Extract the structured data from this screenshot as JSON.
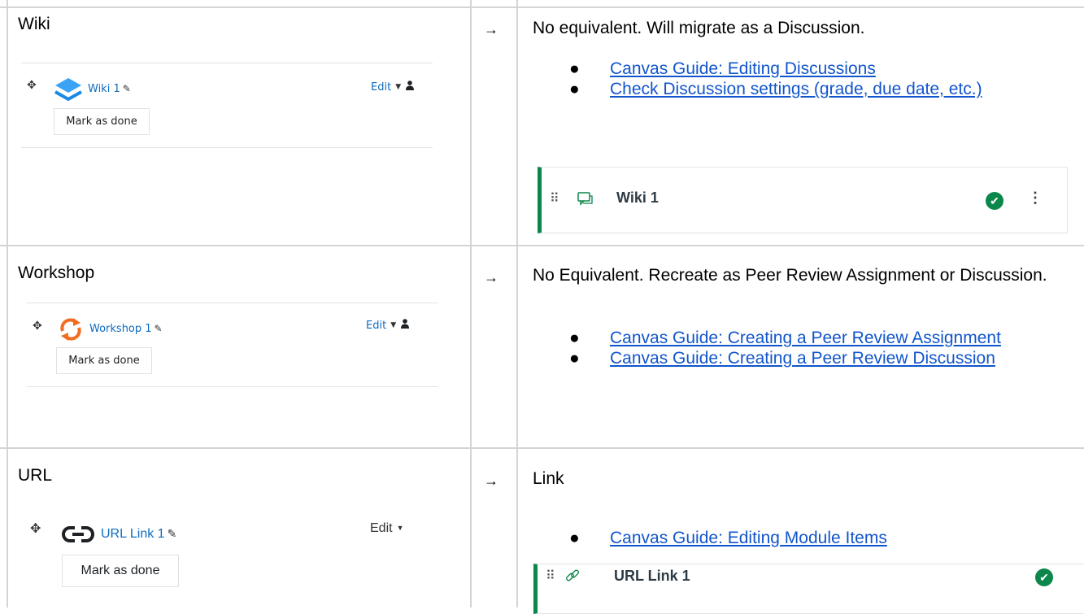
{
  "arrow": "→",
  "rows": [
    {
      "label": "Wiki",
      "moodle": {
        "name": "Wiki 1",
        "edit": "Edit",
        "mark": "Mark as done"
      },
      "desc": "No equivalent. Will migrate as a Discussion.",
      "links": [
        "Canvas Guide: Editing Discussions",
        "Check Discussion settings (grade, due date, etc.)"
      ],
      "canvas_item": "Wiki 1"
    },
    {
      "label": "Workshop",
      "moodle": {
        "name": "Workshop 1",
        "edit": "Edit",
        "mark": "Mark as done"
      },
      "desc": "No Equivalent. Recreate as Peer Review Assignment or Discussion.",
      "links": [
        "Canvas Guide: Creating a Peer Review Assignment",
        "Canvas Guide: Creating a Peer Review Discussion"
      ]
    },
    {
      "label": "URL",
      "moodle": {
        "name": "URL Link 1",
        "edit": "Edit",
        "mark": "Mark as done"
      },
      "desc": "Link",
      "links": [
        "Canvas Guide: Editing Module Items"
      ],
      "canvas_item": "URL Link 1"
    }
  ],
  "colors": {
    "link": "#1155cc",
    "moodle_link": "#0f6cbf",
    "canvas_accent": "#0b874b",
    "grid": "#d4d4d4"
  },
  "icons": {
    "bullet": "●",
    "move": "✥",
    "pencil": "✎",
    "caret": "▼",
    "check": "✔",
    "kebab": "⋮",
    "grip": "⠿"
  }
}
